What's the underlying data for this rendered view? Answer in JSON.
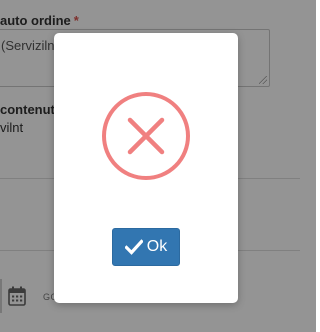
{
  "form": {
    "field1_label": "auto ordine",
    "field1_required_mark": "*",
    "field1_value": "(Servizilnt",
    "field2_label": "contenuto",
    "field2_value": "vilnt",
    "date_hint": "GG"
  },
  "modal": {
    "icon": "error-x-circle-icon",
    "ok_label": "Ok",
    "ok_icon": "check-icon"
  },
  "colors": {
    "overlay": "rgba(0,0,0,0.42)",
    "error_red": "#f08080",
    "button_blue": "#3276b1",
    "required_red": "#d9534f"
  }
}
